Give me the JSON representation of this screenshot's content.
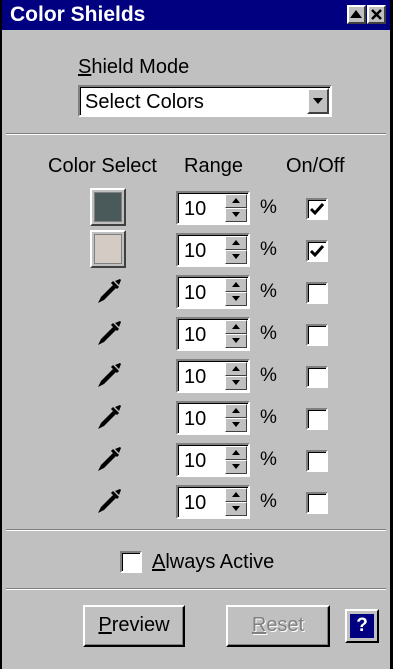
{
  "window": {
    "title": "Color Shields"
  },
  "shield_mode": {
    "label_accel": "S",
    "label_rest": "hield Mode",
    "selected": "Select Colors"
  },
  "headers": {
    "color_select": "Color Select",
    "range": "Range",
    "on_off": "On/Off"
  },
  "rows": [
    {
      "kind": "swatch",
      "color": "#4a5a5a",
      "range": "10",
      "unit": "%",
      "checked": true
    },
    {
      "kind": "swatch",
      "color": "#d4ccc4",
      "range": "10",
      "unit": "%",
      "checked": true
    },
    {
      "kind": "picker",
      "icon": "eyedropper-icon",
      "range": "10",
      "unit": "%",
      "checked": false
    },
    {
      "kind": "picker",
      "icon": "eyedropper-icon",
      "range": "10",
      "unit": "%",
      "checked": false
    },
    {
      "kind": "picker",
      "icon": "eyedropper-icon",
      "range": "10",
      "unit": "%",
      "checked": false
    },
    {
      "kind": "picker",
      "icon": "eyedropper-icon",
      "range": "10",
      "unit": "%",
      "checked": false
    },
    {
      "kind": "picker",
      "icon": "eyedropper-icon",
      "range": "10",
      "unit": "%",
      "checked": false
    },
    {
      "kind": "picker",
      "icon": "eyedropper-icon",
      "range": "10",
      "unit": "%",
      "checked": false
    }
  ],
  "always_active": {
    "accel": "A",
    "rest": "lways Active",
    "checked": false
  },
  "buttons": {
    "preview_accel": "P",
    "preview_rest": "review",
    "reset_accel": "R",
    "reset_rest": "eset",
    "help": "?"
  }
}
